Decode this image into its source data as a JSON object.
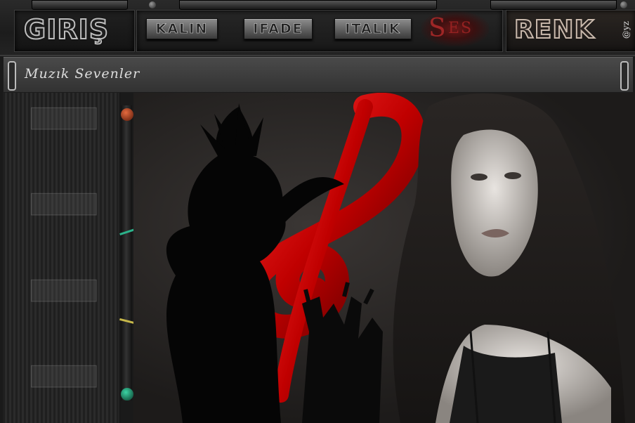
{
  "header": {
    "logo_label": "GIRIŞ",
    "buttons": [
      {
        "id": "kalin",
        "label": "KALIN"
      },
      {
        "id": "ifade",
        "label": "IFADE"
      },
      {
        "id": "italik",
        "label": "ITALIK"
      }
    ],
    "ses_big": "S",
    "ses_small": "ES",
    "renk_label": "RENK",
    "signature": "@yz"
  },
  "titlebar": {
    "title": "Muzık Sevenler"
  },
  "colors": {
    "accent_red": "#d01010",
    "dot_top": "#e46a3e",
    "dot_bottom": "#3bd4a4"
  },
  "icons": {
    "top_dot": "orange-knob-icon",
    "bottom_dot": "green-knob-icon"
  }
}
